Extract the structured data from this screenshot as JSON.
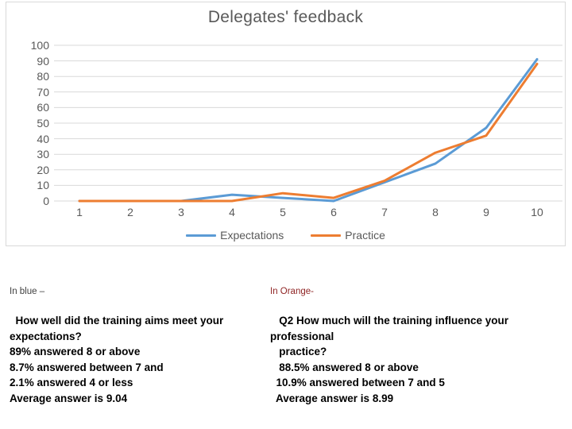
{
  "chart": {
    "title": "Delegates' feedback",
    "border_color": "#d9d9d9"
  },
  "legend": {
    "position": "bottom",
    "entries": [
      {
        "label": "Expectations",
        "color": "#5B9BD5"
      },
      {
        "label": "Practice",
        "color": "#ED7D31"
      }
    ]
  },
  "chart_data": {
    "type": "line",
    "title": "Delegates' feedback",
    "xlabel": "",
    "ylabel": "",
    "x": [
      1,
      2,
      3,
      4,
      5,
      6,
      7,
      8,
      9,
      10
    ],
    "categories": [
      "1",
      "2",
      "3",
      "4",
      "5",
      "6",
      "7",
      "8",
      "9",
      "10"
    ],
    "xtick_labels": [
      "1",
      "2",
      "3",
      "4",
      "5",
      "6",
      "7",
      "8",
      "9",
      "10"
    ],
    "ytick_labels": [
      "0",
      "10",
      "20",
      "30",
      "40",
      "50",
      "60",
      "70",
      "80",
      "90",
      "100"
    ],
    "ylim": [
      0,
      100
    ],
    "ytick_step": 10,
    "grid": "horizontal",
    "legend_position": "bottom",
    "series": [
      {
        "name": "Expectations",
        "color": "#5B9BD5",
        "values": [
          0,
          0,
          0,
          4,
          2,
          0,
          12,
          24,
          47,
          91
        ]
      },
      {
        "name": "Practice",
        "color": "#ED7D31",
        "values": [
          0,
          0,
          0,
          0,
          5,
          2,
          13,
          31,
          42,
          88
        ]
      }
    ]
  },
  "text_blocks": {
    "blue": {
      "heading": "In blue –",
      "lines": [
        "  How well did the training aims meet your",
        "expectations?",
        "89% answered 8 or above",
        "8.7% answered between 7 and",
        "2.1% answered 4 or less",
        "Average answer is 9.04"
      ]
    },
    "orange": {
      "heading": "In Orange-",
      "lines": [
        "   Q2 How much will the training influence your",
        "professional",
        "   practice?",
        "   88.5% answered 8 or above",
        "  10.9% answered between 7 and 5",
        "  Average answer is 8.99"
      ]
    }
  }
}
